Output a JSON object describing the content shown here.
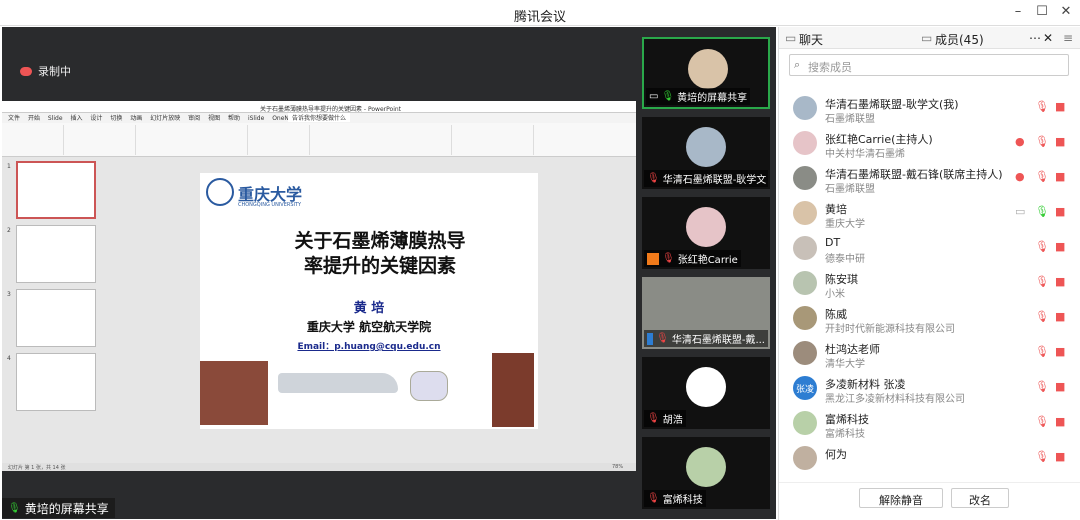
{
  "window": {
    "title": "腾讯会议"
  },
  "stage": {
    "recording": "录制中",
    "share_label": "黄培的屏幕共享"
  },
  "ppt": {
    "doc_title": "关于石墨烯薄膜热导率提升的关键因素 - PowerPoint",
    "tabs": [
      "文件",
      "开始",
      "Slide",
      "插入",
      "设计",
      "切换",
      "动画",
      "幻灯片放映",
      "审阅",
      "视图",
      "帮助",
      "iSlide",
      "OneNote XII"
    ],
    "search_hint": "告诉我你想要做什么",
    "slide_numbers": [
      "1",
      "2",
      "3",
      "4"
    ],
    "status_left": "幻灯片 第 1 张，共 14 张",
    "zoom": "78%"
  },
  "slide": {
    "university": "重庆大学",
    "university_en": "CHONGQING UNIVERSITY",
    "title_line1": "关于石墨烯薄膜热导",
    "title_line2": "率提升的关键因素",
    "author": "黄 培",
    "affiliation": "重庆大学 航空航天学院",
    "email": "Email：p.huang@cqu.edu.cn"
  },
  "videos": [
    {
      "name": "黄培的屏幕共享"
    },
    {
      "name": "华清石墨烯联盟-耿学文"
    },
    {
      "name": "张红艳Carrie"
    },
    {
      "name": "华清石墨烯联盟-戴..."
    },
    {
      "name": "胡浩"
    },
    {
      "name": "富烯科技"
    }
  ],
  "panel": {
    "tab_chat": "聊天",
    "tab_members": "成员(45)",
    "search_placeholder": "搜索成员",
    "members": [
      {
        "name": "华清石墨烯联盟-耿学文(我)",
        "org": "石墨烯联盟"
      },
      {
        "name": "张红艳Carrie(主持人)",
        "org": "中关村华清石墨烯"
      },
      {
        "name": "华清石墨烯联盟-戴石锋(联席主持人)",
        "org": "石墨烯联盟"
      },
      {
        "name": "黄培",
        "org": "重庆大学"
      },
      {
        "name": "DT",
        "org": "德泰中研"
      },
      {
        "name": "陈安琪",
        "org": "小米"
      },
      {
        "name": "陈威",
        "org": "开封时代新能源科技有限公司"
      },
      {
        "name": "杜鸿达老师",
        "org": "清华大学"
      },
      {
        "name": "多凌新材料 张凌",
        "org": "黑龙江多凌新材料科技有限公司",
        "avatar_text": "张凌"
      },
      {
        "name": "富烯科技",
        "org": "富烯科技"
      },
      {
        "name": "何为",
        "org": ""
      }
    ],
    "btn_unmute_all": "解除静音",
    "btn_rename": "改名"
  },
  "colors": {
    "accent_green": "#2aa84a",
    "muted_red": "#e55",
    "brand_blue": "#2d7dd2"
  }
}
